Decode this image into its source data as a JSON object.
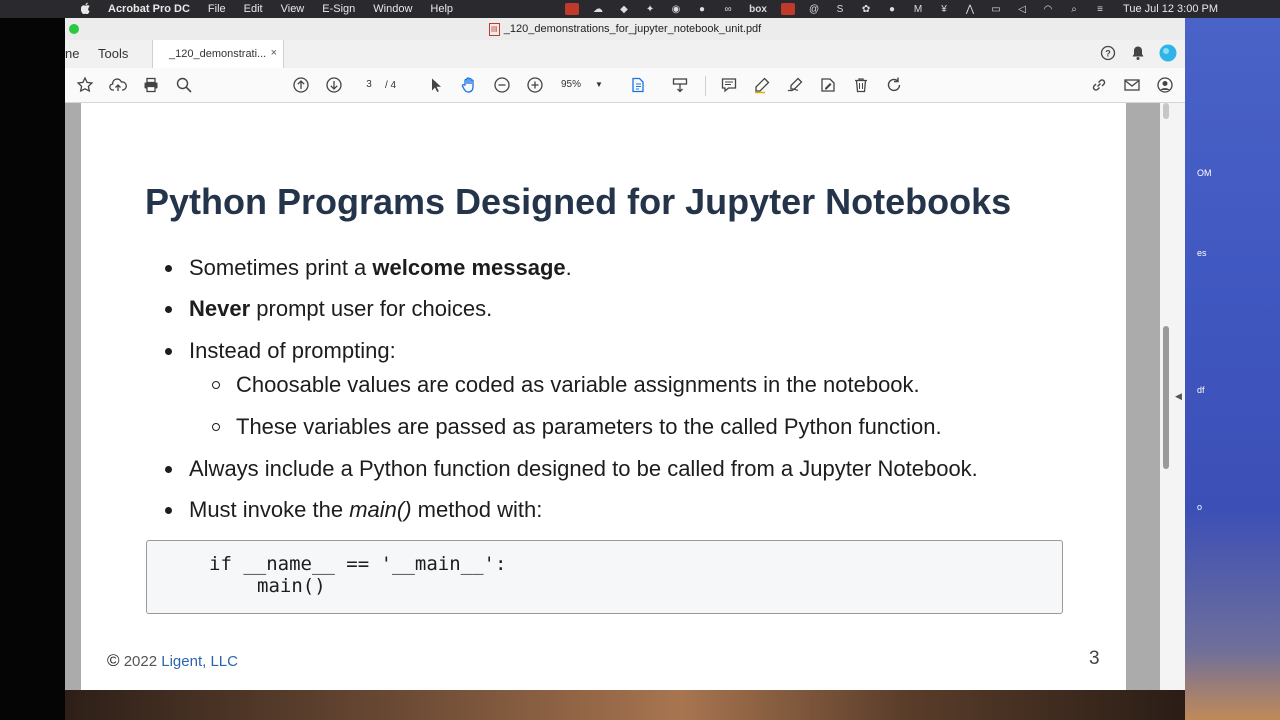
{
  "menubar": {
    "app_name": "Acrobat Pro DC",
    "menus": [
      "File",
      "Edit",
      "View",
      "E-Sign",
      "Window",
      "Help"
    ],
    "clock": "Tue Jul 12  3:00 PM",
    "status_icons": [
      "adobe-icon",
      "cloud-icon",
      "cube-icon",
      "dropbox-icon",
      "circle-icon",
      "chrome-icon",
      "link-icon",
      "box-icon",
      "record-icon",
      "at-icon",
      "s-icon",
      "gear-icon",
      "dot-icon",
      "m-icon",
      "scale-icon",
      "activity-icon",
      "display-icon",
      "volume-icon",
      "wifi-icon",
      "search-icon",
      "control-center-icon"
    ]
  },
  "window": {
    "title": "_120_demonstrations_for_jupyter_notebook_unit.pdf"
  },
  "tabs": {
    "home": "ne",
    "tools": "Tools",
    "document": "_120_demonstrati...",
    "close": "×"
  },
  "toolbar": {
    "page_current": "3",
    "page_total": "/  4",
    "zoom": "95%"
  },
  "slide": {
    "title": "Python Programs Designed for Jupyter Notebooks",
    "bullets": [
      {
        "pre": "Sometimes print a ",
        "bold": "welcome message",
        "post": "."
      },
      {
        "bold": "Never",
        "post": " prompt user for choices."
      },
      {
        "text": "Instead of prompting:"
      },
      {
        "text": "Choosable values are coded as variable assignments in the notebook."
      },
      {
        "text": "These variables are passed as parameters to the called Python function."
      },
      {
        "text": "Always include a Python function designed to be called from a Jupyter Notebook."
      },
      {
        "pre": "Must invoke the ",
        "italic": "main()",
        "post": " method with:"
      }
    ],
    "code_line1": "if __name__ == '__main__':",
    "code_line2": "main()",
    "footer_symbol": "©",
    "footer_year": "2022 ",
    "footer_link": "Ligent, LLC",
    "page_number": "3"
  },
  "desktop": {
    "labels": [
      "OM",
      "es",
      "df",
      "o"
    ]
  }
}
